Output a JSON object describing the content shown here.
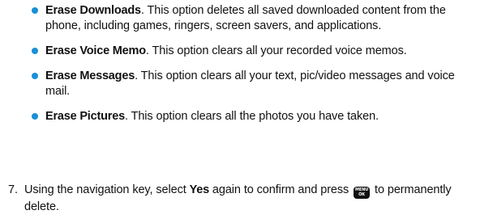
{
  "bullets": [
    {
      "term": "Erase Downloads",
      "text": ". This option deletes all saved downloaded content from the phone, including games, ringers, screen savers, and applications."
    },
    {
      "term": "Erase Voice Memo",
      "text": ". This option clears all your recorded voice memos."
    },
    {
      "term": "Erase Messages",
      "text": ". This option clears all your text, pic/video messages and voice mail."
    },
    {
      "term": "Erase Pictures",
      "text": ". This option clears all the photos you have taken."
    }
  ],
  "step": {
    "number": "7.",
    "text_before": "Using the navigation key, select ",
    "bold": "Yes",
    "text_middle": " again to confirm and press ",
    "key_top": "MENU",
    "key_bottom": "OK",
    "text_after": " to permanently delete."
  },
  "colors": {
    "bullet": "#1a8fd6",
    "text": "#111111"
  }
}
